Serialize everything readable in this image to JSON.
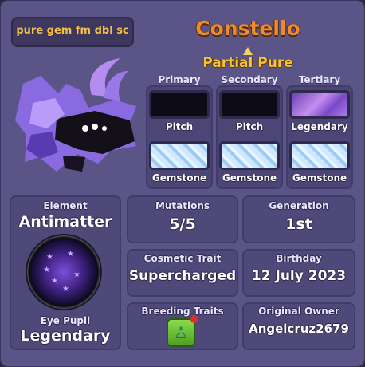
{
  "nickname": "pure gem fm dbl sc",
  "pet_name": "Constello",
  "subtitle": "Partial Pure",
  "colors": {
    "columns": [
      {
        "header": "Primary",
        "top": {
          "label": "Pitch",
          "swatch": "#0d0b16"
        },
        "bottom": {
          "label": "Gemstone",
          "swatch": "#bfe0fb"
        }
      },
      {
        "header": "Secondary",
        "top": {
          "label": "Pitch",
          "swatch": "#0d0b16"
        },
        "bottom": {
          "label": "Gemstone",
          "swatch": "#bfe0fb"
        }
      },
      {
        "header": "Tertiary",
        "top": {
          "label": "Legendary",
          "swatch": "#9a6ae0"
        },
        "bottom": {
          "label": "Gemstone",
          "swatch": "#bfe0fb"
        }
      }
    ]
  },
  "element": {
    "label": "Element",
    "value": "Antimatter"
  },
  "eye_pupil": {
    "label": "Eye Pupil",
    "value": "Legendary"
  },
  "mutations": {
    "label": "Mutations",
    "value": "5/5"
  },
  "generation": {
    "label": "Generation",
    "value": "1st"
  },
  "cosmetic_trait": {
    "label": "Cosmetic Trait",
    "value": "Supercharged"
  },
  "birthday": {
    "label": "Birthday",
    "value": "12 July 2023"
  },
  "breeding_traits": {
    "label": "Breeding Traits",
    "icon": "breeding-trait-icon"
  },
  "original_owner": {
    "label": "Original Owner",
    "value": "Angelcruz2679"
  },
  "theme": {
    "name_color": "#f08a2c",
    "subtitle_color": "#f5c23a",
    "nickname_color": "#f5c04a",
    "panel": "#4e4978",
    "frame": "#5a5586"
  }
}
